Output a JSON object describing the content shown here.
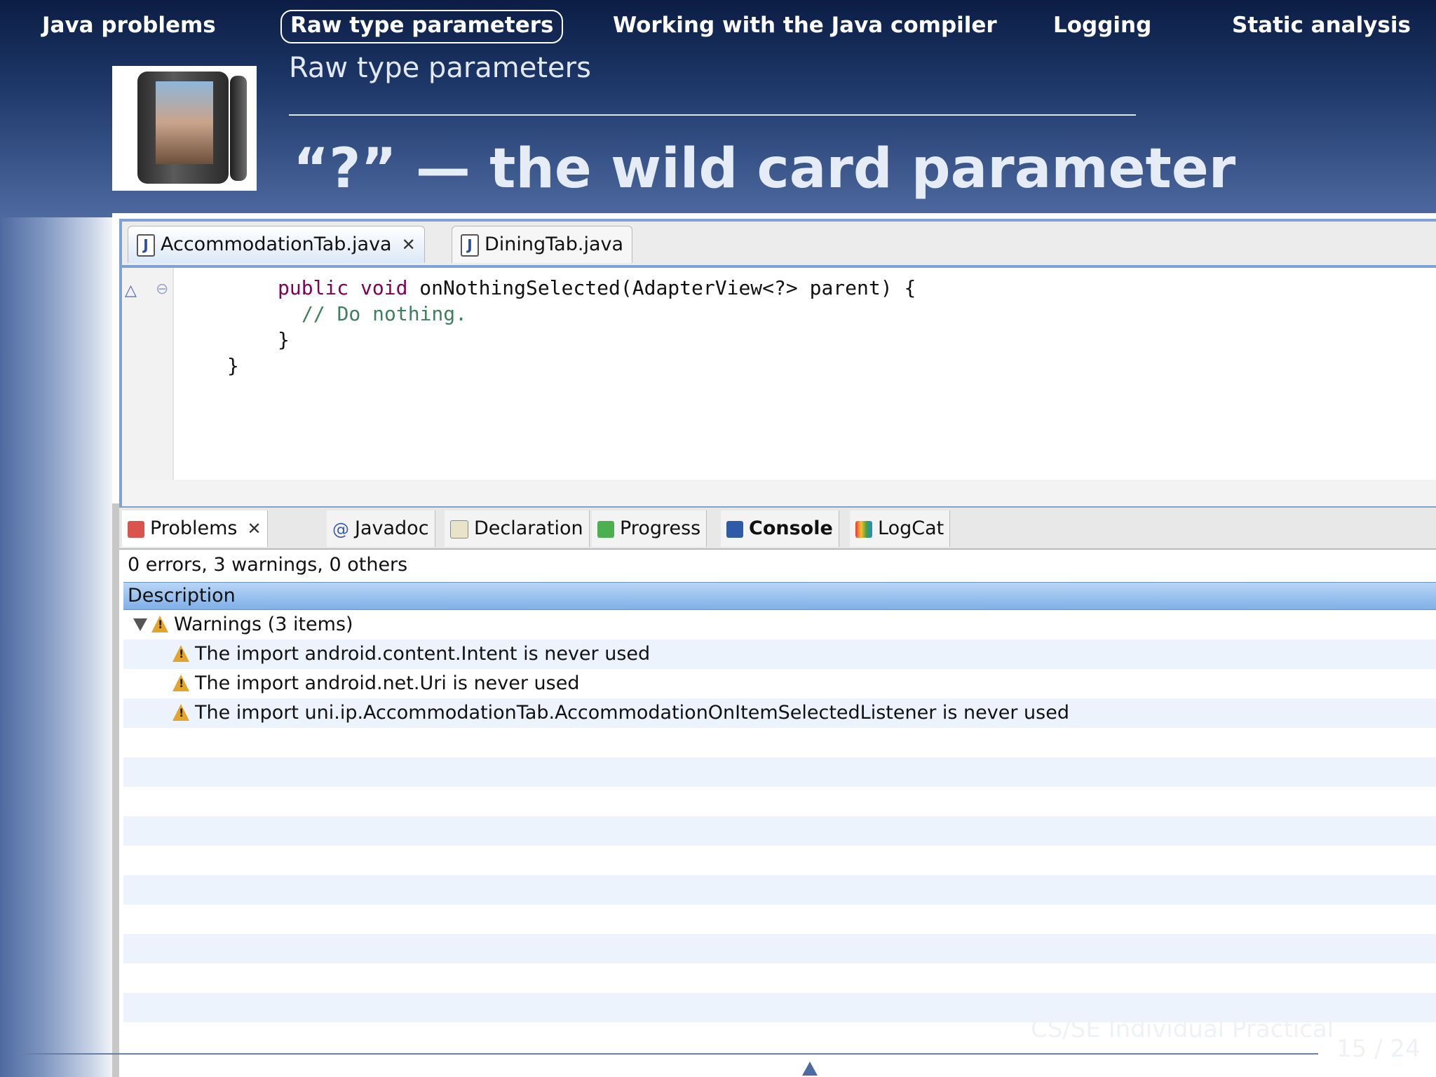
{
  "nav": {
    "items": [
      "Java problems",
      "Raw type parameters",
      "Working with the Java compiler",
      "Logging",
      "Static analysis"
    ],
    "active_index": 1
  },
  "slide": {
    "subtitle": "Raw type parameters",
    "title": "“?” — the wild card parameter"
  },
  "editor": {
    "tabs": [
      "AccommodationTab.java",
      "DiningTab.java"
    ],
    "active_tab": 0,
    "code": {
      "line1_kw": "public void",
      "line1_rest": " onNothingSelected(AdapterView<?> parent) {",
      "line2": "// Do nothing.",
      "line3": "}",
      "line4": "}"
    }
  },
  "views": {
    "tabs": [
      "Problems",
      "Javadoc",
      "Declaration",
      "Progress",
      "Console",
      "LogCat"
    ],
    "icons": [
      "problems-icon",
      "javadoc-icon",
      "declaration-icon",
      "progress-icon",
      "console-icon",
      "logcat-icon"
    ],
    "active_tab": 0,
    "summary": "0 errors, 3 warnings, 0 others",
    "column_header": "Description",
    "group_label": "Warnings (3 items)",
    "warnings": [
      "The import android.content.Intent is never used",
      "The import android.net.Uri is never used",
      "The import uni.ip.AccommodationTab.AccommodationOnItemSelectedListener is never used"
    ]
  },
  "footer": {
    "text": "CS/SE Individual Practical",
    "page": "15 / 24"
  }
}
